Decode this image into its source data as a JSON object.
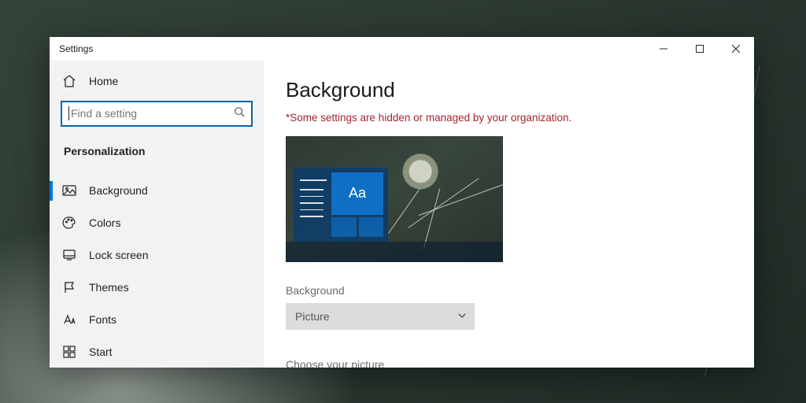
{
  "window": {
    "title": "Settings"
  },
  "sidebar": {
    "home": "Home",
    "search_placeholder": "Find a setting",
    "section": "Personalization",
    "items": [
      {
        "id": "background",
        "label": "Background",
        "selected": true
      },
      {
        "id": "colors",
        "label": "Colors",
        "selected": false
      },
      {
        "id": "lockscreen",
        "label": "Lock screen",
        "selected": false
      },
      {
        "id": "themes",
        "label": "Themes",
        "selected": false
      },
      {
        "id": "fonts",
        "label": "Fonts",
        "selected": false
      },
      {
        "id": "start",
        "label": "Start",
        "selected": false
      }
    ]
  },
  "main": {
    "heading": "Background",
    "warning": "*Some settings are hidden or managed by your organization.",
    "preview_sample_text": "Aa",
    "bg_label": "Background",
    "bg_value": "Picture",
    "choose_label": "Choose your picture"
  }
}
